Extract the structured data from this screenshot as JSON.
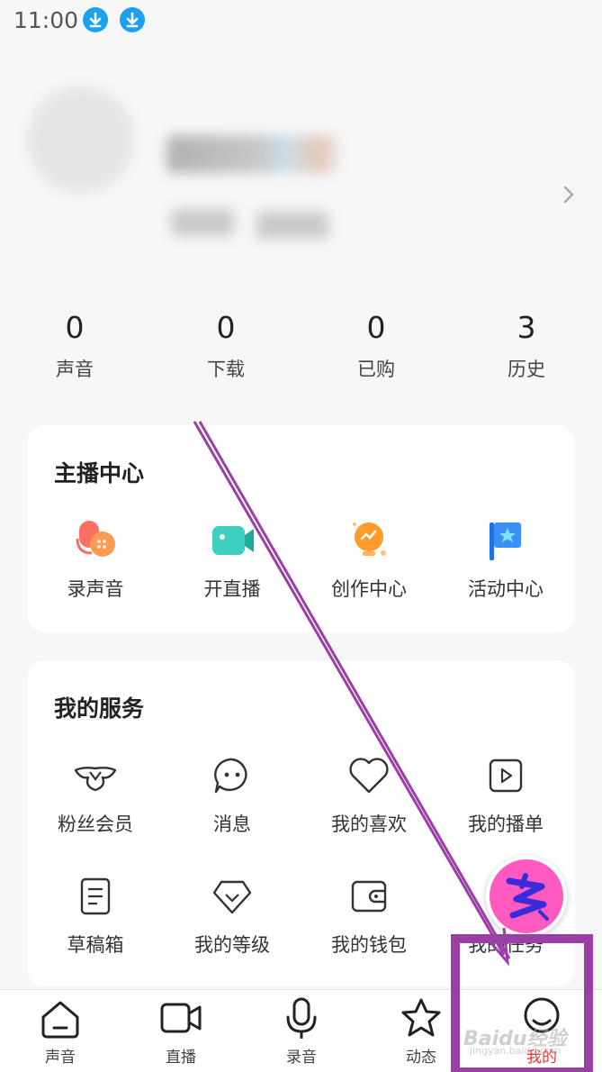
{
  "status": {
    "time": "11:00",
    "icons": [
      "download-icon",
      "download-icon"
    ]
  },
  "stats": [
    {
      "value": "0",
      "label": "声音"
    },
    {
      "value": "0",
      "label": "下载"
    },
    {
      "value": "0",
      "label": "已购"
    },
    {
      "value": "3",
      "label": "历史"
    }
  ],
  "anchor_center": {
    "title": "主播中心",
    "items": [
      {
        "label": "录声音",
        "icon": "record-voice-icon"
      },
      {
        "label": "开直播",
        "icon": "live-camera-icon"
      },
      {
        "label": "创作中心",
        "icon": "creation-bulb-icon"
      },
      {
        "label": "活动中心",
        "icon": "activity-flag-icon"
      }
    ]
  },
  "my_services": {
    "title": "我的服务",
    "items": [
      {
        "label": "粉丝会员",
        "icon": "fan-member-icon"
      },
      {
        "label": "消息",
        "icon": "message-icon"
      },
      {
        "label": "我的喜欢",
        "icon": "heart-icon"
      },
      {
        "label": "我的播单",
        "icon": "playlist-icon"
      },
      {
        "label": "草稿箱",
        "icon": "draft-icon"
      },
      {
        "label": "我的等级",
        "icon": "level-icon"
      },
      {
        "label": "我的钱包",
        "icon": "wallet-icon"
      },
      {
        "label": "我的任务",
        "icon": "task-icon"
      }
    ]
  },
  "tabbar": [
    {
      "label": "声音",
      "icon": "home-icon",
      "active": false
    },
    {
      "label": "直播",
      "icon": "video-icon",
      "active": false
    },
    {
      "label": "录音",
      "icon": "microphone-icon",
      "active": false
    },
    {
      "label": "动态",
      "icon": "star-icon",
      "active": false
    },
    {
      "label": "我的",
      "icon": "profile-icon",
      "active": true
    }
  ],
  "colors": {
    "active_tab": "#e23a3a",
    "annotation": "#9b3fa6",
    "badge": "#ff5ac0"
  },
  "watermark": {
    "brand": "Baidu经验",
    "url": "jingyan.baidu.com"
  }
}
